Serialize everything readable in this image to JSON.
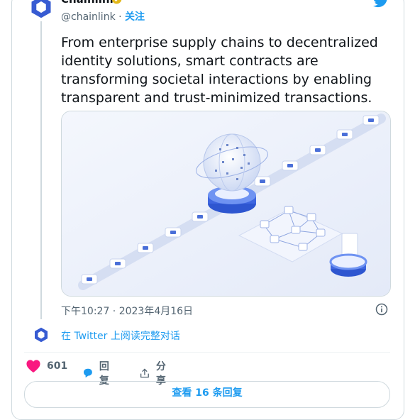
{
  "author": {
    "name": "Chainlink",
    "handle": "@chainlink",
    "separator": " · ",
    "follow_label": "关注"
  },
  "tweet": {
    "text": "From enterprise supply chains to decentralized identity solutions, smart contracts are transforming societal interactions by enabling transparent and trust-minimized transactions.",
    "timestamp": "下午10:27 · 2023年4月16日"
  },
  "read_link": "在 Twitter 上阅读完整对话",
  "actions": {
    "likes": "601",
    "reply_label": "回复",
    "share_label": "分享"
  },
  "replies_button": "查看 16 条回复",
  "colors": {
    "accent": "#1d9bf0",
    "like": "#f91880",
    "chainlink": "#375bd2"
  }
}
